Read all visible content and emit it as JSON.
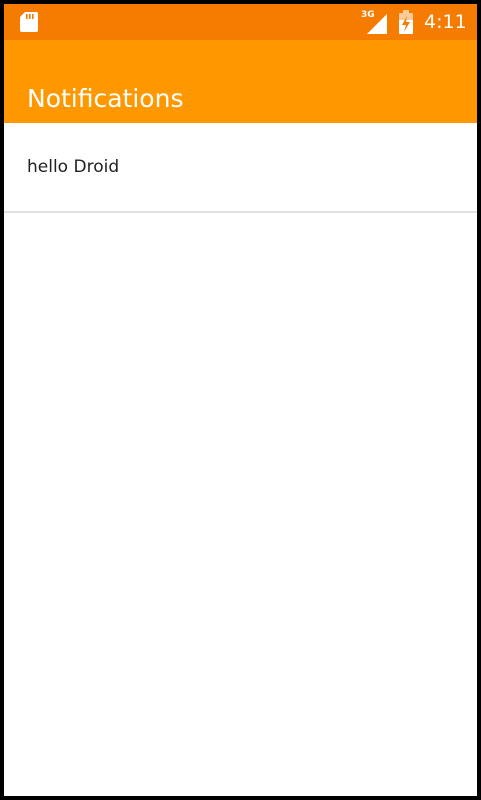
{
  "status_bar": {
    "network_type": "3G",
    "time": "4:11",
    "icons": [
      "sd-card-icon",
      "signal-icon",
      "battery-charging-icon"
    ],
    "color": "#f57c00"
  },
  "app_bar": {
    "title": "Notifications",
    "color": "#ff9800"
  },
  "notifications": [
    {
      "text": "hello Droid"
    }
  ]
}
